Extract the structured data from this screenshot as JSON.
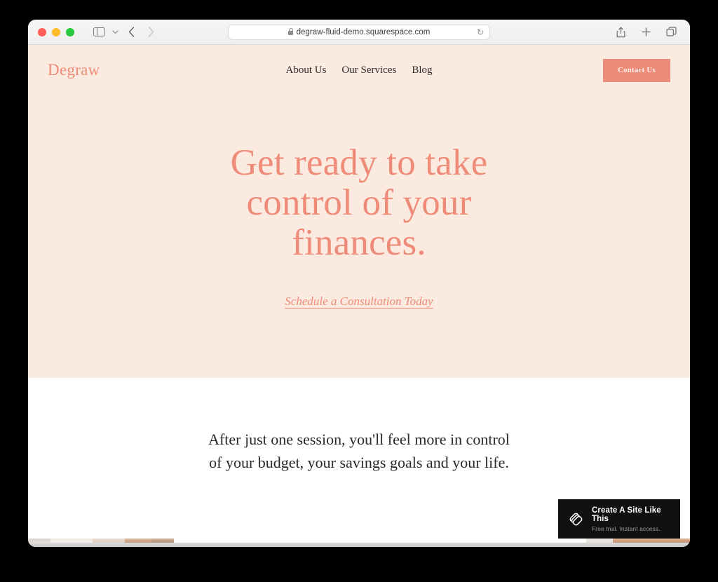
{
  "browser": {
    "traffic_lights": [
      "close",
      "minimize",
      "maximize"
    ],
    "sidebar_toggle_label": "Show sidebar",
    "tab_overview_label": "Tab overview",
    "back_label": "Back",
    "forward_label": "Forward",
    "url": "degraw-fluid-demo.squarespace.com",
    "lock_icon": "lock-icon",
    "reload_glyph": "↻",
    "share_glyph": "↑",
    "new_tab_glyph": "+",
    "tabs_glyph": "⧉"
  },
  "site": {
    "logo": "Degraw",
    "nav": [
      {
        "label": "About Us"
      },
      {
        "label": "Our Services"
      },
      {
        "label": "Blog"
      }
    ],
    "contact_button": "Contact Us",
    "hero": {
      "title": "Get ready to take control of your finances.",
      "cta_link": "Schedule a Consultation Today"
    },
    "intro": {
      "paragraph": "After just one session, you'll feel more in control of your budget, your savings goals and your life."
    }
  },
  "badge": {
    "title": "Create A Site Like This",
    "subtitle": "Free trial. Instant access.",
    "logo_name": "squarespace-logo-icon"
  },
  "colors": {
    "hero_background": "#fbeae0",
    "accent": "#ef8b79",
    "text_dark": "#2b2826",
    "badge_background": "#111111"
  }
}
